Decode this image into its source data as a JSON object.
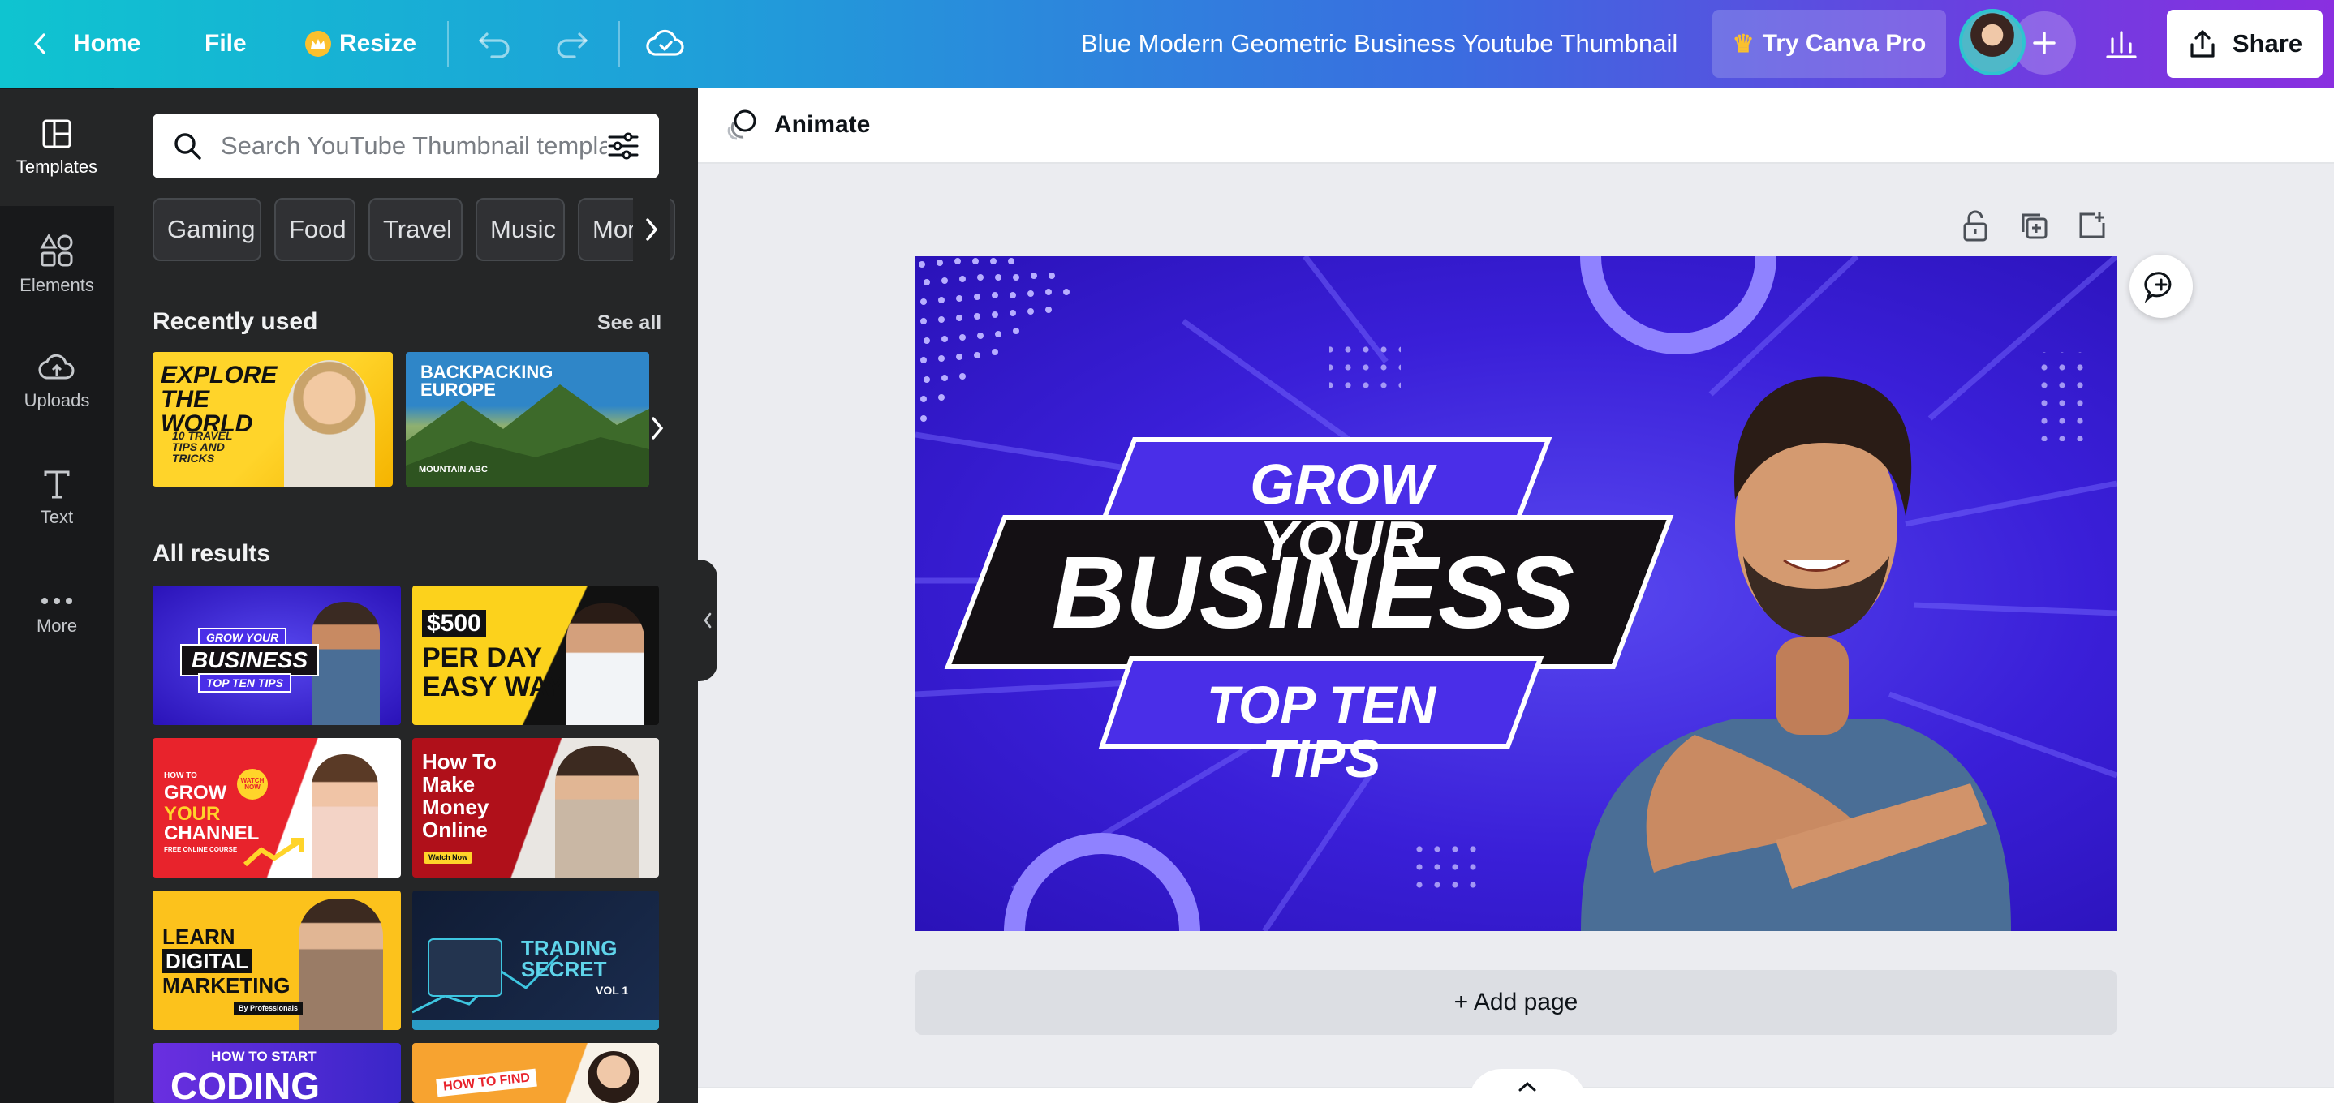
{
  "topbar": {
    "home": "Home",
    "file": "File",
    "resize": "Resize",
    "title": "Blue Modern Geometric Business Youtube Thumbnail",
    "try_pro": "Try Canva Pro",
    "share": "Share"
  },
  "rail": [
    {
      "label": "Templates",
      "icon": "templates-icon"
    },
    {
      "label": "Elements",
      "icon": "elements-icon"
    },
    {
      "label": "Uploads",
      "icon": "uploads-icon"
    },
    {
      "label": "Text",
      "icon": "text-icon"
    },
    {
      "label": "More",
      "icon": "more-icon"
    }
  ],
  "panel": {
    "search_placeholder": "Search YouTube Thumbnail templates",
    "chips": [
      "Gaming",
      "Food",
      "Travel",
      "Music",
      "Money"
    ],
    "recently_used": "Recently used",
    "see_all": "See all",
    "all_results": "All results",
    "recent": [
      {
        "title": "EXPLORE THE WORLD",
        "sub": "10 TRAVEL TIPS AND TRICKS"
      },
      {
        "title": "BACKPACKING EUROPE",
        "sub": "MOUNTAIN ABC"
      }
    ],
    "results": [
      {
        "l1": "GROW YOUR",
        "l2": "BUSINESS",
        "l3": "TOP TEN TIPS"
      },
      {
        "l1": "$500",
        "l2": "PER DAY",
        "l3": "EASY WAY"
      },
      {
        "l1": "HOW TO",
        "l2": "GROW",
        "l3": "YOUR",
        "l4": "CHANNEL",
        "l5": "FREE ONLINE COURSE",
        "badge": "WATCH NOW"
      },
      {
        "l1": "How To",
        "l2": "Make",
        "l3": "Money",
        "l4": "Online",
        "l5": "Watch Now"
      },
      {
        "l1": "LEARN",
        "l2": "DIGITAL",
        "l3": "MARKETING",
        "l4": "By Professionals"
      },
      {
        "l1": "TRADING",
        "l2": "SECRET",
        "l3": "VOL 1"
      },
      {
        "l1": "HOW TO START",
        "l2": "CODING"
      },
      {
        "l1": "HOW TO FIND"
      }
    ]
  },
  "workspace": {
    "animate": "Animate",
    "add_page": "+ Add page"
  },
  "design": {
    "line1": "GROW YOUR",
    "line2": "BUSINESS",
    "line3": "TOP TEN TIPS"
  },
  "colors": {
    "canvas_blue": "#3a1fd8",
    "accent_purple": "#4a2ee8",
    "banner_black": "#141014"
  }
}
